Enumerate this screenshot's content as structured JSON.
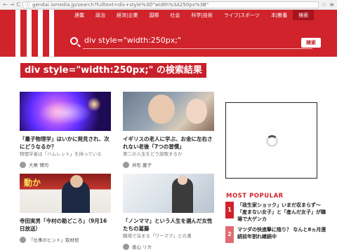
{
  "browser": {
    "back": "←",
    "forward": "→",
    "reload": "C",
    "url": "gendai.ismedia.jp/search?fulltext=div+style%3D\"width%3A250px%3B\"",
    "star": "☆",
    "menu": "≡"
  },
  "nav": {
    "items": [
      "連載",
      "政治",
      "経済|企業",
      "国際",
      "社会",
      "科学|技術",
      "ライフ|スポーツ",
      "本|教養",
      "検索"
    ],
    "active_index": 8
  },
  "search": {
    "query": "div style=\"width:250px;\"",
    "button_label": "検索"
  },
  "result_heading": "div style=\"width:250px;\" の検索結果",
  "articles": [
    {
      "title": "「量子物理学」はいかに発見され、次にどうなるか？",
      "subtitle": "物理学者は「ハムレット」を持っている",
      "author": "大栗 博司",
      "image": "galaxy"
    },
    {
      "title": "イギリスの老人に学ぶ、お金に左右されない老後「7つの習慣」",
      "subtitle": "第二の人生をどう謳歌するか",
      "author": "井形 慶子",
      "image": "elderly"
    },
    {
      "title": "寺田実男「今村の勘どころ」（9月16日放送）",
      "subtitle": "",
      "author": "「仕事のヒント」取材班",
      "image": "tv",
      "image_caption": "動か"
    },
    {
      "title": "「ノンママ」という人生を選んだ女性たちの葛藤",
      "subtitle": "職場で深まる「ワーママ」との溝",
      "author": "香山 リカ",
      "image": "office"
    }
  ],
  "popular": {
    "heading": "MOST POPULAR",
    "items": [
      {
        "rank": "1",
        "text": "「政生家ショック」いまだ収まらず～「産まない女子」と「産んだ女子」が職場で大ゲンカ",
        "color": "#d0232c"
      },
      {
        "rank": "2",
        "text": "マツダの快進撃に陰り？ なんと8ヵ月連続前年割れ継続中",
        "color": "#e06b72"
      }
    ]
  }
}
